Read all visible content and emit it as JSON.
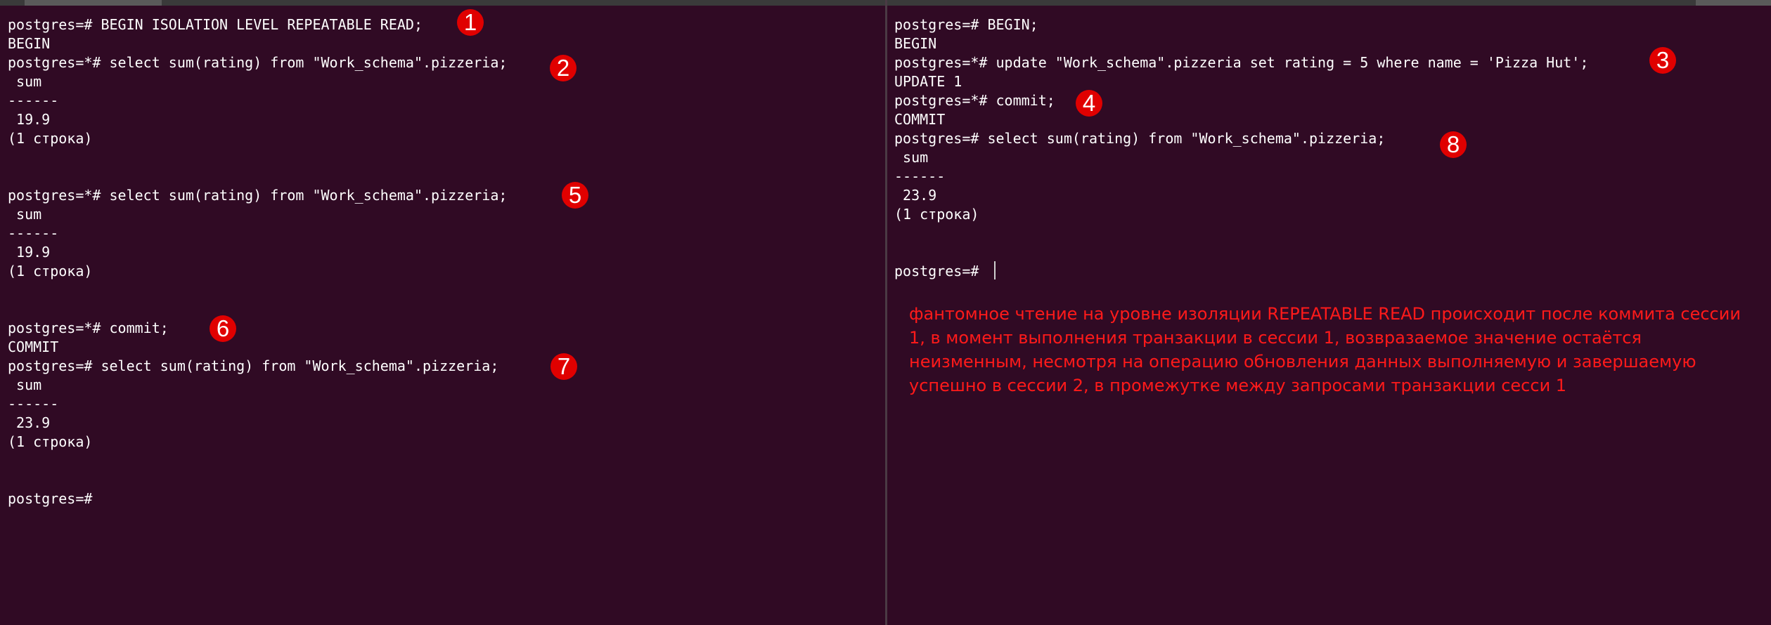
{
  "left_session": {
    "lines": [
      "postgres=# BEGIN ISOLATION LEVEL REPEATABLE READ;",
      "BEGIN",
      "postgres=*# select sum(rating) from \"Work_schema\".pizzeria;",
      " sum",
      "------",
      " 19.9",
      "(1 строка)",
      "",
      "",
      "postgres=*# select sum(rating) from \"Work_schema\".pizzeria;",
      " sum",
      "------",
      " 19.9",
      "(1 строка)",
      "",
      "",
      "postgres=*# commit;",
      "COMMIT",
      "postgres=# select sum(rating) from \"Work_schema\".pizzeria;",
      " sum",
      "------",
      " 23.9",
      "(1 строка)",
      "",
      "",
      "postgres=#"
    ]
  },
  "right_session": {
    "lines": [
      "postgres=# BEGIN;",
      "BEGIN",
      "postgres=*# update \"Work_schema\".pizzeria set rating = 5 where name = 'Pizza Hut';",
      "UPDATE 1",
      "postgres=*# commit;",
      "COMMIT",
      "postgres=# select sum(rating) from \"Work_schema\".pizzeria;",
      " sum",
      "------",
      " 23.9",
      "(1 строка)",
      "",
      "",
      "postgres=#"
    ]
  },
  "annotations": {
    "step_1": "1",
    "step_2": "2",
    "step_3": "3",
    "step_4": "4",
    "step_5": "5",
    "step_6": "6",
    "step_7": "7",
    "step_8": "8",
    "note": "фантомное чтение на уровне изоляции REPEATABLE READ происходит после коммита сессии 1, в момент выполнения транзакции в сессии 1, возвразаемое значение остаётся неизменным, несмотря на операцию обновления данных выполняемую и завершаемую успешно в сессии 2, в промежутке между запросами транзакции сесси 1"
  },
  "colors": {
    "terminal_background": "#300a24",
    "terminal_text": "#ffffff",
    "annotation_red": "#e00000",
    "note_text": "#ff1a1a"
  }
}
